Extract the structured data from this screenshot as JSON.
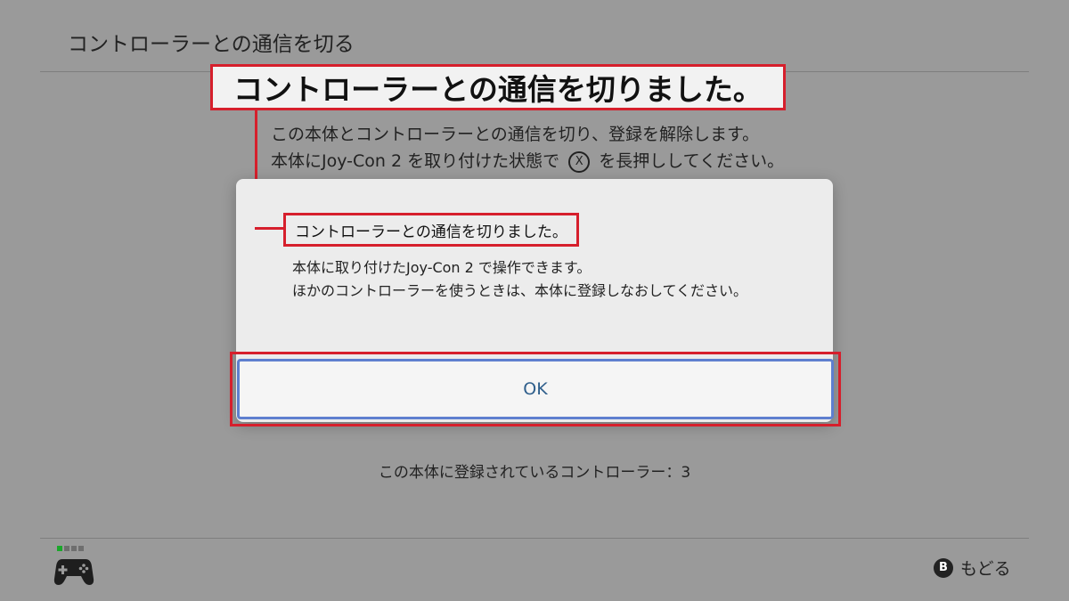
{
  "header": {
    "title": "コントローラーとの通信を切る"
  },
  "callout": {
    "big_text": "コントローラーとの通信を切りました。"
  },
  "background": {
    "desc_line1": "この本体とコントローラーとの通信を切り、登録を解除します。",
    "desc_line2_before": "本体にJoy-Con 2 を取り付けた状態で",
    "x_button_label": "X",
    "desc_line2_after": "を長押ししてください。"
  },
  "dialog": {
    "title": "コントローラーとの通信を切りました。",
    "body_line1": "本体に取り付けたJoy-Con 2 で操作できます。",
    "body_line2": "ほかのコントローラーを使うときは、本体に登録しなおしてください。",
    "ok_label": "OK"
  },
  "status": {
    "registered_controllers": "この本体に登録されているコントローラー：3"
  },
  "footer": {
    "back_button_glyph": "B",
    "back_label": "もどる",
    "player_indicator_active": 1,
    "player_indicator_total": 4,
    "controller_icon": "gamepad-icon"
  },
  "colors": {
    "highlight": "#d61f2c",
    "ok_text": "#2f5f8c",
    "ok_border": "#5e7fcf",
    "player_active": "#1aa72a"
  }
}
